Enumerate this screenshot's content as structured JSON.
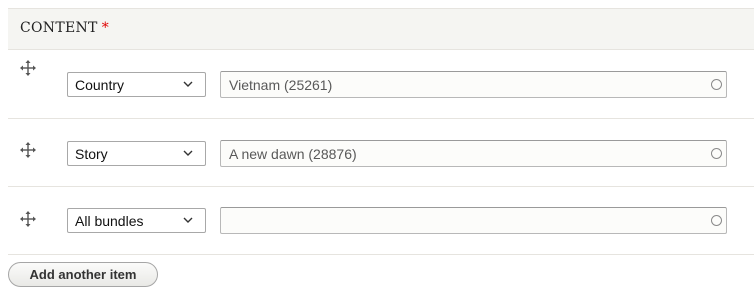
{
  "section": {
    "title": "CONTENT",
    "required_marker": "*"
  },
  "rows": [
    {
      "bundle": "Country",
      "value": "Vietnam (25261)"
    },
    {
      "bundle": "Story",
      "value": "A new dawn (28876)"
    },
    {
      "bundle": "All bundles",
      "value": ""
    }
  ],
  "add_button_label": "Add another item",
  "colors": {
    "required": "#e00000",
    "header_bg": "#f5f5f2",
    "border": "#e6e4df"
  },
  "icons": {
    "drag": "move-arrows-icon",
    "dropdown": "chevron-down-icon",
    "autocomplete": "autocomplete-circle-icon"
  }
}
